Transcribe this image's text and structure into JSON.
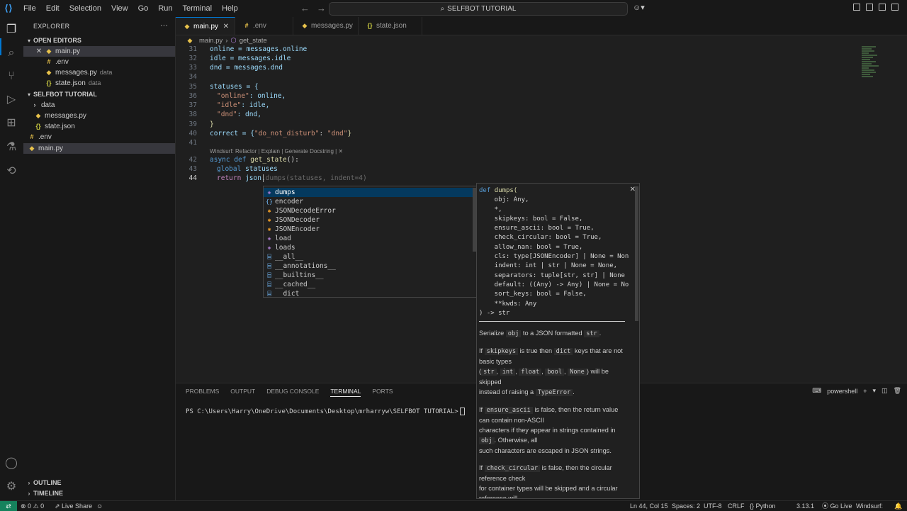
{
  "titlebar": {
    "menu": [
      "File",
      "Edit",
      "Selection",
      "View",
      "Go",
      "Run",
      "Terminal",
      "Help"
    ],
    "search_text": "SELFBOT TUTORIAL"
  },
  "sidebar": {
    "title": "EXPLORER",
    "open_editors_header": "OPEN EDITORS",
    "open_editors": [
      {
        "name": "main.py",
        "desc": ""
      },
      {
        "name": ".env",
        "desc": ""
      },
      {
        "name": "messages.py",
        "desc": "data"
      },
      {
        "name": "state.json",
        "desc": "data"
      }
    ],
    "project_header": "SELFBOT TUTORIAL",
    "tree": [
      {
        "name": "data"
      },
      {
        "name": "messages.py"
      },
      {
        "name": "state.json"
      },
      {
        "name": ".env"
      },
      {
        "name": "main.py"
      }
    ],
    "outline_header": "OUTLINE",
    "timeline_header": "TIMELINE"
  },
  "tabs": [
    {
      "label": "main.py"
    },
    {
      "label": ".env"
    },
    {
      "label": "messages.py"
    },
    {
      "label": "state.json"
    }
  ],
  "breadcrumb": {
    "file": "main.py",
    "symbol": "get_state"
  },
  "editor": {
    "line_numbers": [
      "31",
      "32",
      "33",
      "34",
      "35",
      "36",
      "37",
      "38",
      "39",
      "40",
      "41",
      "42",
      "43",
      "44"
    ],
    "codelens": "Windsurf: Refactor | Explain | Generate Docstring | ✕",
    "lines": {
      "l31": "online = messages.online",
      "l32": "idle = messages.idle",
      "l33": "dnd = messages.dnd",
      "l35": "statuses = {",
      "l36_key": "\"online\"",
      "l36_val": ": online,",
      "l37_key": "\"idle\"",
      "l37_val": ": idle,",
      "l38_key": "\"dnd\"",
      "l38_val": ": dnd,",
      "l39": "}",
      "l40_a": "correct = {",
      "l40_k": "\"do_not_disturb\"",
      "l40_m": ": ",
      "l40_v": "\"dnd\"",
      "l40_b": "}",
      "l42_kw": "async def",
      "l42_fn": "get_state",
      "l42_rest": "():",
      "l43_kw": "global",
      "l43_var": "statuses",
      "l44_kw": "return",
      "l44_obj": "json.",
      "l44_ghost": "dumps(statuses, indent=4)"
    }
  },
  "suggest": {
    "items": [
      {
        "label": "dumps",
        "kind": "fnc"
      },
      {
        "label": "encoder",
        "kind": "mod"
      },
      {
        "label": "JSONDecodeError",
        "kind": "cls"
      },
      {
        "label": "JSONDecoder",
        "kind": "cls"
      },
      {
        "label": "JSONEncoder",
        "kind": "cls"
      },
      {
        "label": "load",
        "kind": "fnc"
      },
      {
        "label": "loads",
        "kind": "fnc"
      },
      {
        "label": "__all__",
        "kind": "var"
      },
      {
        "label": "__annotations__",
        "kind": "var"
      },
      {
        "label": "__builtins__",
        "kind": "var"
      },
      {
        "label": "__cached__",
        "kind": "var"
      },
      {
        "label": "__dict__",
        "kind": "var"
      }
    ]
  },
  "details": {
    "signature": [
      "def dumps(",
      "    obj: Any,",
      "    *,",
      "    skipkeys: bool = False,",
      "    ensure_ascii: bool = True,",
      "    check_circular: bool = True,",
      "    allow_nan: bool = True,",
      "    cls: type[JSONEncoder] | None = Non",
      "    indent: int | str | None = None,",
      "    separators: tuple[str, str] | None",
      "    default: ((Any) -> Any) | None = No",
      "    sort_keys: bool = False,",
      "    **kwds: Any",
      ") -> str"
    ],
    "doc": {
      "p1_a": "Serialize",
      "p1_code1": "obj",
      "p1_b": "to a JSON formatted",
      "p1_code2": "str",
      "p1_c": ".",
      "p2_a": "If",
      "p2_code1": "skipkeys",
      "p2_b": "is true then",
      "p2_code2": "dict",
      "p2_c": "keys that are not basic types",
      "p2_d": "(",
      "p2_t1": "str",
      "p2_t2": "int",
      "p2_t3": "float",
      "p2_t4": "bool",
      "p2_t5": "None",
      "p2_e": ") will be skipped",
      "p2_f": "instead of raising a",
      "p2_code3": "TypeError",
      "p2_g": ".",
      "p3_a": "If",
      "p3_code1": "ensure_ascii",
      "p3_b": "is false, then the return value can contain non-ASCII",
      "p3_c": "characters if they appear in strings contained in",
      "p3_code2": "obj",
      "p3_d": ". Otherwise, all",
      "p3_e": "such characters are escaped in JSON strings.",
      "p4_a": "If",
      "p4_code1": "check_circular",
      "p4_b": "is false, then the circular reference check",
      "p4_c": "for container types will be skipped and a circular reference will"
    }
  },
  "panel": {
    "tabs": [
      "PROBLEMS",
      "OUTPUT",
      "DEBUG CONSOLE",
      "TERMINAL",
      "PORTS"
    ],
    "active_tab": "TERMINAL",
    "shell": "powershell",
    "prompt": "PS C:\\Users\\Harry\\OneDrive\\Documents\\Desktop\\mrharryw\\SELFBOT TUTORIAL>"
  },
  "statusbar": {
    "errors": "0",
    "warnings": "0",
    "live_share": "Live Share",
    "position": "Ln 44, Col 15",
    "spaces": "Spaces: 2",
    "encoding": "UTF-8",
    "eol": "CRLF",
    "language": "Python",
    "version": "3.13.1",
    "go_live": "Go Live",
    "windsurf": "Windsurf:"
  },
  "colors": {
    "accent": "#0078d4",
    "selection": "#04395e",
    "remote": "#16825d"
  }
}
